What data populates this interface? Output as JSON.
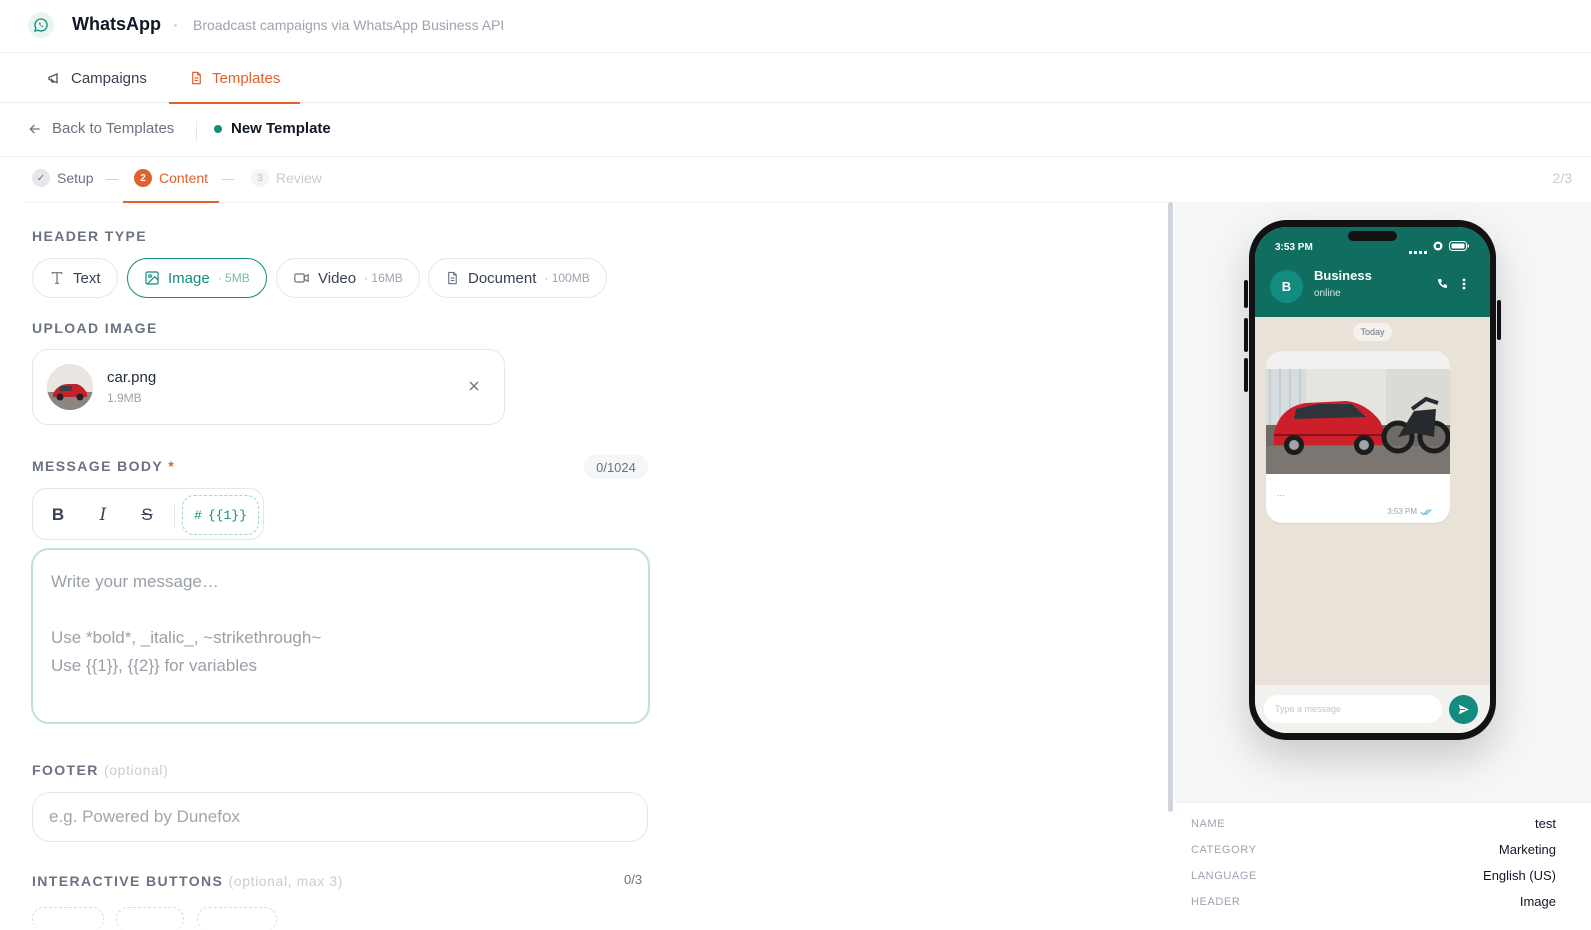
{
  "app": {
    "title": "WhatsApp",
    "subtitle": "Broadcast campaigns via WhatsApp Business API"
  },
  "nav": {
    "tabs": [
      {
        "label": "Campaigns",
        "icon": "megaphone-icon",
        "active": false
      },
      {
        "label": "Templates",
        "icon": "document-icon",
        "active": true
      }
    ]
  },
  "breadcrumb": {
    "back_label": "Back to Templates",
    "current_label": "New Template"
  },
  "stepper": {
    "steps": [
      {
        "num": "✓",
        "label": "Setup",
        "state": "done"
      },
      {
        "num": "2",
        "label": "Content",
        "state": "active"
      },
      {
        "num": "3",
        "label": "Review",
        "state": "todo"
      }
    ],
    "progress": "2/3"
  },
  "header_type": {
    "label": "HEADER TYPE",
    "options": [
      {
        "label": "Text",
        "size": "",
        "active": false
      },
      {
        "label": "Image",
        "size": "· 5MB",
        "active": true
      },
      {
        "label": "Video",
        "size": "· 16MB",
        "active": false
      },
      {
        "label": "Document",
        "size": "· 100MB",
        "active": false
      }
    ]
  },
  "upload": {
    "label": "UPLOAD IMAGE",
    "file_name": "car.png",
    "file_size": "1.9MB"
  },
  "message_body": {
    "label": "MESSAGE BODY",
    "required_mark": "*",
    "char_count": "0/1024",
    "format_buttons": {
      "bold": "B",
      "italic": "I",
      "strike": "S",
      "variable_hash": "#",
      "variable": "{{1}}"
    },
    "placeholder": "Write your message…\n\nUse *bold*, _italic_, ~strikethrough~\nUse {{1}}, {{2}} for variables"
  },
  "footer": {
    "label": "FOOTER",
    "optional": "(optional)",
    "placeholder": "e.g. Powered by Dunefox"
  },
  "buttons": {
    "label": "INTERACTIVE BUTTONS",
    "optional": "(optional, max 3)",
    "count": "0/3"
  },
  "preview": {
    "status_time": "3:53 PM",
    "contact_initial": "B",
    "contact_name": "Business",
    "contact_status": "online",
    "day_label": "Today",
    "body_preview": "...",
    "message_time": "3:53 PM",
    "input_placeholder": "Type a message",
    "accent": "#128c7e",
    "header_color": "#0f6e5f"
  },
  "summary": {
    "rows": [
      {
        "key": "NAME",
        "value": "test"
      },
      {
        "key": "CATEGORY",
        "value": "Marketing"
      },
      {
        "key": "LANGUAGE",
        "value": "English (US)"
      },
      {
        "key": "HEADER",
        "value": "Image"
      }
    ]
  },
  "colors": {
    "brand_orange": "#e0622e",
    "whatsapp_green": "#128c7e"
  }
}
